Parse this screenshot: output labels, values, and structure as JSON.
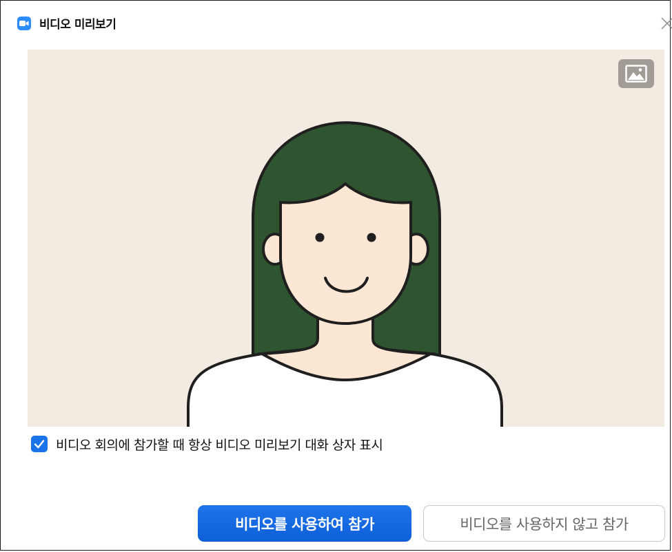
{
  "window": {
    "title": "비디오 미리보기",
    "app_icon": "video-camera-icon",
    "close_icon": "close-icon"
  },
  "preview": {
    "background_color": "#f2ebe1",
    "change_background_icon": "image-icon"
  },
  "checkbox": {
    "checked": true,
    "label": "비디오 회의에 참가할 때 항상 비디오 미리보기 대화 상자 표시"
  },
  "buttons": {
    "join_with_video": "비디오를 사용하여 참가",
    "join_without_video": "비디오를 사용하지 않고 참가"
  },
  "colors": {
    "accent": "#0e6ee6",
    "hair": "#2e5430",
    "skin": "#fce6d4"
  }
}
